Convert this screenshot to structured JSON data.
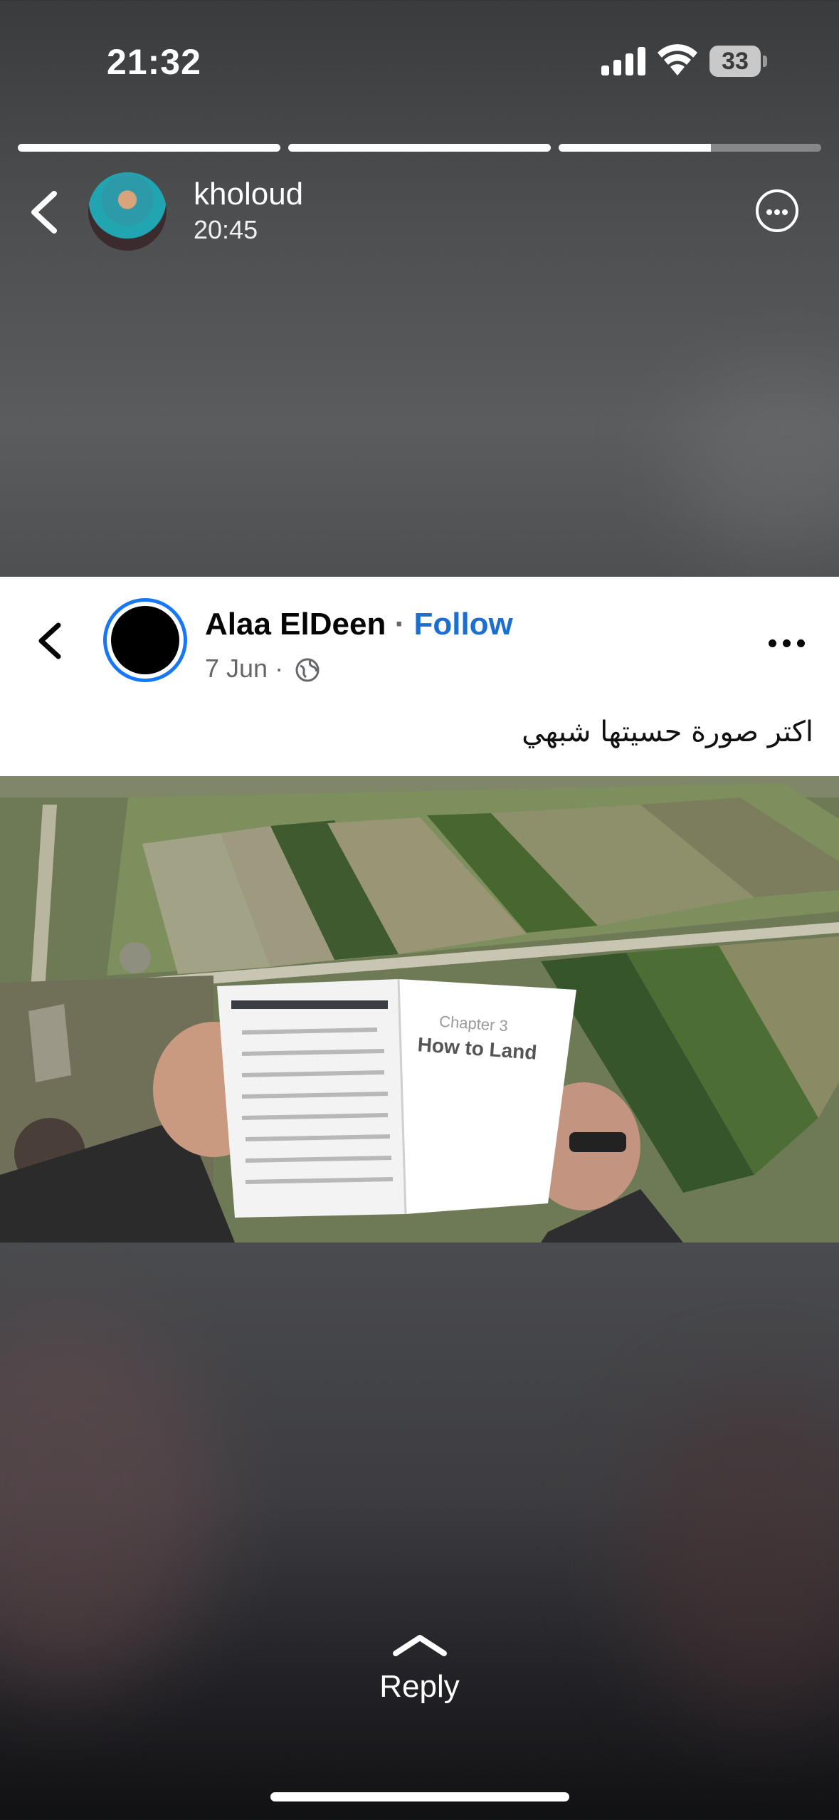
{
  "status_bar": {
    "time": "21:32",
    "battery": "33"
  },
  "story": {
    "progress": [
      1.0,
      1.0,
      0.58
    ],
    "username": "kholoud",
    "posted_time": "20:45"
  },
  "post": {
    "author": "Alaa ElDeen",
    "separator": "·",
    "follow_label": "Follow",
    "date": "7 Jun ·",
    "caption": "اكتر صورة حسيتها شبهي",
    "photo_text": {
      "chapter": "Chapter 3",
      "title": "How to Land"
    }
  },
  "reply": {
    "label": "Reply"
  },
  "colors": {
    "follow_accent": "#1b6fd3",
    "avatar_ring": "#1877f2"
  },
  "icons": [
    "back-chevron-icon",
    "more-options-icon",
    "globe-icon",
    "swipe-up-chevron-icon",
    "signal-icon",
    "wifi-icon",
    "battery-icon"
  ]
}
